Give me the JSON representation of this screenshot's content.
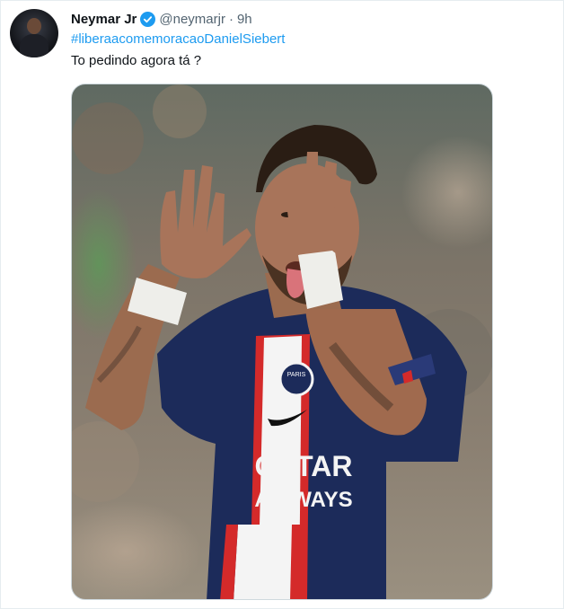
{
  "tweet": {
    "display_name": "Neymar Jr",
    "handle": "@neymarjr",
    "separator": "·",
    "time": "9h",
    "hashtag": "#liberaacomemoracaoDanielSiebert",
    "text": "To pedindo agora tá ?",
    "verified": true
  },
  "jersey": {
    "sponsor_line1": "QATAR",
    "sponsor_line2": "AIRWAYS",
    "crest_text": "PARIS"
  },
  "colors": {
    "link": "#1d9bf0",
    "name": "#0f1419",
    "muted": "#536471",
    "jersey_navy": "#1a2a5c",
    "jersey_red": "#d42a2a"
  },
  "icons": {
    "verified": "verified-badge-icon"
  }
}
